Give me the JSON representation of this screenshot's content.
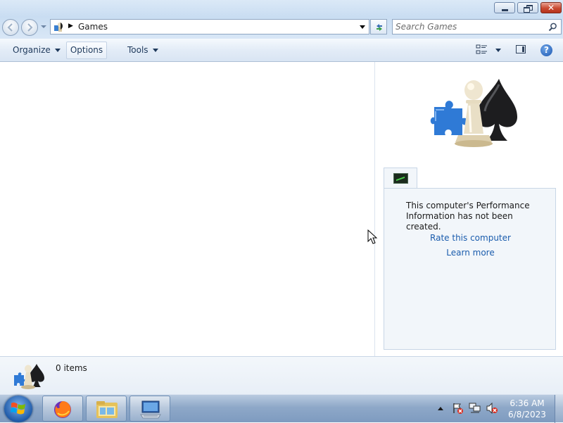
{
  "window": {
    "minimize_icon": "minimize-icon",
    "maximize_icon": "restore-icon",
    "close_label": "✕"
  },
  "address_bar": {
    "path": "Games",
    "search_placeholder": "Search Games"
  },
  "toolbar": {
    "organize_label": "Organize",
    "options_label": "Options",
    "tools_label": "Tools",
    "help_label": "?"
  },
  "preview": {
    "performance_message": "This computer's Performance Information has not been created.",
    "rate_link": "Rate this computer",
    "learn_link": "Learn more"
  },
  "details": {
    "item_count": "0 items"
  },
  "taskbar": {
    "items": [
      "firefox-icon",
      "explorer-icon",
      "remote-desktop-icon"
    ],
    "tray_icons": [
      "show-hidden-icons",
      "action-center-icon",
      "network-icon",
      "volume-muted-icon"
    ],
    "time": "6:36 AM",
    "date": "6/8/2023"
  },
  "colors": {
    "link": "#1a5cad",
    "toolbar_text": "#1e395b",
    "close_button": "#c94a32"
  }
}
